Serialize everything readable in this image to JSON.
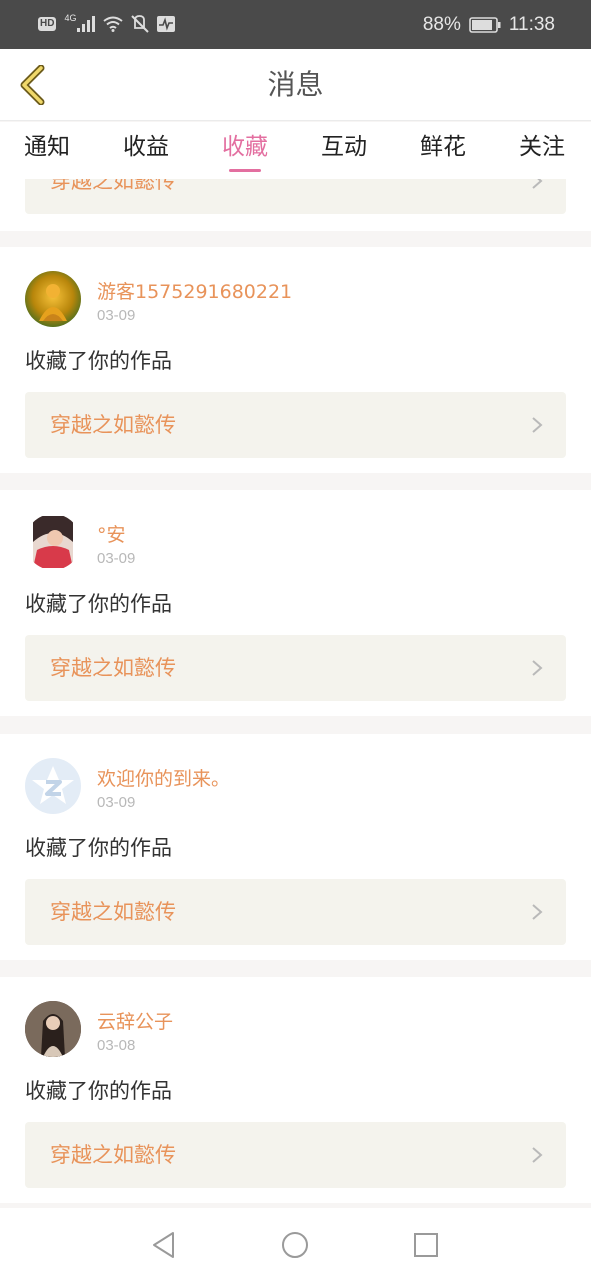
{
  "status_bar": {
    "hd": "HD",
    "network": "4G",
    "battery": "88%",
    "time": "11:38"
  },
  "nav": {
    "title": "消息",
    "back_icon": "chevron-left-icon"
  },
  "tabs": [
    {
      "label": "通知",
      "active": false
    },
    {
      "label": "收益",
      "active": false
    },
    {
      "label": "收藏",
      "active": true
    },
    {
      "label": "互动",
      "active": false
    },
    {
      "label": "鲜花",
      "active": false
    },
    {
      "label": "关注",
      "active": false
    }
  ],
  "partial_card": {
    "work_title": "穿越之如懿传"
  },
  "items": [
    {
      "user": "游客1575291680221",
      "date": "03-09",
      "action": "收藏了你的作品",
      "work_title": "穿越之如懿传"
    },
    {
      "user": "°安",
      "date": "03-09",
      "action": "收藏了你的作品",
      "work_title": "穿越之如懿传"
    },
    {
      "user": "欢迎你的到来。",
      "date": "03-09",
      "action": "收藏了你的作品",
      "work_title": "穿越之如懿传"
    },
    {
      "user": "云辞公子",
      "date": "03-08",
      "action": "收藏了你的作品",
      "work_title": "穿越之如懿传"
    }
  ],
  "colors": {
    "accent_pink": "#e36fa0",
    "accent_orange": "#e8935a",
    "box_bg": "#f4f3ed"
  }
}
